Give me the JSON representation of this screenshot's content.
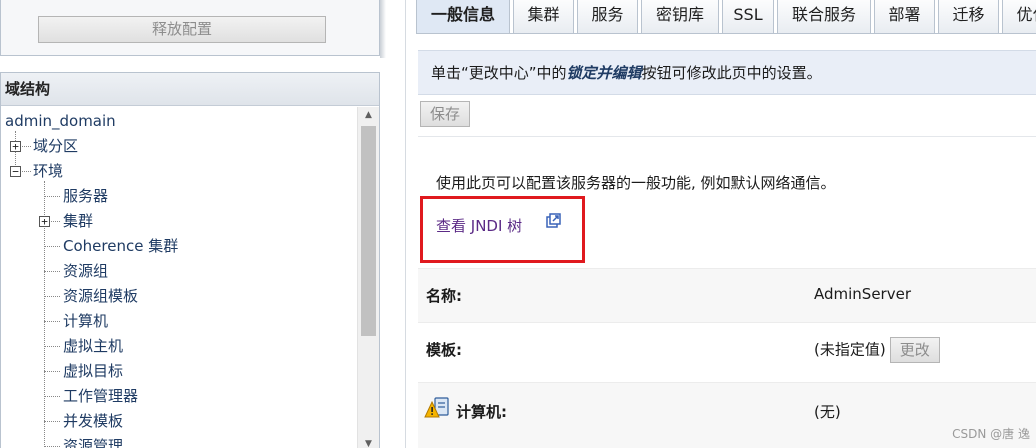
{
  "release_panel": {
    "button_label": "释放配置"
  },
  "domain_structure": {
    "title": "域结构",
    "root": "admin_domain",
    "items": [
      {
        "label": "域分区",
        "expander": "+"
      },
      {
        "label": "环境",
        "expander": "−"
      },
      {
        "label": "服务器"
      },
      {
        "label": "集群",
        "expander": "+"
      },
      {
        "label": "Coherence 集群"
      },
      {
        "label": "资源组"
      },
      {
        "label": "资源组模板"
      },
      {
        "label": "计算机"
      },
      {
        "label": "虚拟主机"
      },
      {
        "label": "虚拟目标"
      },
      {
        "label": "工作管理器"
      },
      {
        "label": "并发模板"
      },
      {
        "label": "资源管理"
      }
    ]
  },
  "tabs": [
    {
      "label": "一般信息",
      "active": true
    },
    {
      "label": "集群"
    },
    {
      "label": "服务"
    },
    {
      "label": "密钥库"
    },
    {
      "label": "SSL"
    },
    {
      "label": "联合服务"
    },
    {
      "label": "部署"
    },
    {
      "label": "迁移"
    },
    {
      "label": "优化"
    }
  ],
  "info": {
    "text_before": "单击“更改中心”中的",
    "emphasis": "锁定并编辑",
    "text_after": "按钮可修改此页中的设置。"
  },
  "save_label": "保存",
  "description": "使用此页可以配置该服务器的一般功能, 例如默认网络通信。",
  "jndi_link": "查看 JNDI 树",
  "fields": {
    "name": {
      "label": "名称:",
      "value": "AdminServer"
    },
    "template": {
      "label": "模板:",
      "value": "(未指定值)",
      "button": "更改"
    },
    "machine": {
      "label": "计算机:",
      "value": "(无)"
    }
  },
  "watermark": "CSDN @唐 逸",
  "colors": {
    "highlight_box": "#e0191e",
    "link": "#5b2a86",
    "info_bg": "#e9eef7"
  }
}
